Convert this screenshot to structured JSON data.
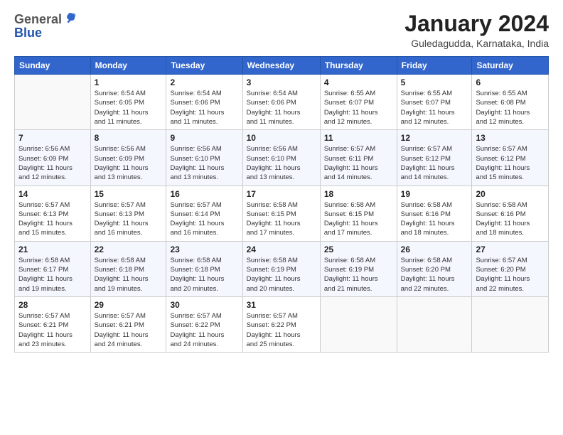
{
  "header": {
    "logo": {
      "line1": "General",
      "line2": "Blue"
    },
    "title": "January 2024",
    "location": "Guledagudda, Karnataka, India"
  },
  "calendar": {
    "days_of_week": [
      "Sunday",
      "Monday",
      "Tuesday",
      "Wednesday",
      "Thursday",
      "Friday",
      "Saturday"
    ],
    "weeks": [
      [
        {
          "day": "",
          "detail": ""
        },
        {
          "day": "1",
          "detail": "Sunrise: 6:54 AM\nSunset: 6:05 PM\nDaylight: 11 hours\nand 11 minutes."
        },
        {
          "day": "2",
          "detail": "Sunrise: 6:54 AM\nSunset: 6:06 PM\nDaylight: 11 hours\nand 11 minutes."
        },
        {
          "day": "3",
          "detail": "Sunrise: 6:54 AM\nSunset: 6:06 PM\nDaylight: 11 hours\nand 11 minutes."
        },
        {
          "day": "4",
          "detail": "Sunrise: 6:55 AM\nSunset: 6:07 PM\nDaylight: 11 hours\nand 12 minutes."
        },
        {
          "day": "5",
          "detail": "Sunrise: 6:55 AM\nSunset: 6:07 PM\nDaylight: 11 hours\nand 12 minutes."
        },
        {
          "day": "6",
          "detail": "Sunrise: 6:55 AM\nSunset: 6:08 PM\nDaylight: 11 hours\nand 12 minutes."
        }
      ],
      [
        {
          "day": "7",
          "detail": "Sunrise: 6:56 AM\nSunset: 6:09 PM\nDaylight: 11 hours\nand 12 minutes."
        },
        {
          "day": "8",
          "detail": "Sunrise: 6:56 AM\nSunset: 6:09 PM\nDaylight: 11 hours\nand 13 minutes."
        },
        {
          "day": "9",
          "detail": "Sunrise: 6:56 AM\nSunset: 6:10 PM\nDaylight: 11 hours\nand 13 minutes."
        },
        {
          "day": "10",
          "detail": "Sunrise: 6:56 AM\nSunset: 6:10 PM\nDaylight: 11 hours\nand 13 minutes."
        },
        {
          "day": "11",
          "detail": "Sunrise: 6:57 AM\nSunset: 6:11 PM\nDaylight: 11 hours\nand 14 minutes."
        },
        {
          "day": "12",
          "detail": "Sunrise: 6:57 AM\nSunset: 6:12 PM\nDaylight: 11 hours\nand 14 minutes."
        },
        {
          "day": "13",
          "detail": "Sunrise: 6:57 AM\nSunset: 6:12 PM\nDaylight: 11 hours\nand 15 minutes."
        }
      ],
      [
        {
          "day": "14",
          "detail": "Sunrise: 6:57 AM\nSunset: 6:13 PM\nDaylight: 11 hours\nand 15 minutes."
        },
        {
          "day": "15",
          "detail": "Sunrise: 6:57 AM\nSunset: 6:13 PM\nDaylight: 11 hours\nand 16 minutes."
        },
        {
          "day": "16",
          "detail": "Sunrise: 6:57 AM\nSunset: 6:14 PM\nDaylight: 11 hours\nand 16 minutes."
        },
        {
          "day": "17",
          "detail": "Sunrise: 6:58 AM\nSunset: 6:15 PM\nDaylight: 11 hours\nand 17 minutes."
        },
        {
          "day": "18",
          "detail": "Sunrise: 6:58 AM\nSunset: 6:15 PM\nDaylight: 11 hours\nand 17 minutes."
        },
        {
          "day": "19",
          "detail": "Sunrise: 6:58 AM\nSunset: 6:16 PM\nDaylight: 11 hours\nand 18 minutes."
        },
        {
          "day": "20",
          "detail": "Sunrise: 6:58 AM\nSunset: 6:16 PM\nDaylight: 11 hours\nand 18 minutes."
        }
      ],
      [
        {
          "day": "21",
          "detail": "Sunrise: 6:58 AM\nSunset: 6:17 PM\nDaylight: 11 hours\nand 19 minutes."
        },
        {
          "day": "22",
          "detail": "Sunrise: 6:58 AM\nSunset: 6:18 PM\nDaylight: 11 hours\nand 19 minutes."
        },
        {
          "day": "23",
          "detail": "Sunrise: 6:58 AM\nSunset: 6:18 PM\nDaylight: 11 hours\nand 20 minutes."
        },
        {
          "day": "24",
          "detail": "Sunrise: 6:58 AM\nSunset: 6:19 PM\nDaylight: 11 hours\nand 20 minutes."
        },
        {
          "day": "25",
          "detail": "Sunrise: 6:58 AM\nSunset: 6:19 PM\nDaylight: 11 hours\nand 21 minutes."
        },
        {
          "day": "26",
          "detail": "Sunrise: 6:58 AM\nSunset: 6:20 PM\nDaylight: 11 hours\nand 22 minutes."
        },
        {
          "day": "27",
          "detail": "Sunrise: 6:57 AM\nSunset: 6:20 PM\nDaylight: 11 hours\nand 22 minutes."
        }
      ],
      [
        {
          "day": "28",
          "detail": "Sunrise: 6:57 AM\nSunset: 6:21 PM\nDaylight: 11 hours\nand 23 minutes."
        },
        {
          "day": "29",
          "detail": "Sunrise: 6:57 AM\nSunset: 6:21 PM\nDaylight: 11 hours\nand 24 minutes."
        },
        {
          "day": "30",
          "detail": "Sunrise: 6:57 AM\nSunset: 6:22 PM\nDaylight: 11 hours\nand 24 minutes."
        },
        {
          "day": "31",
          "detail": "Sunrise: 6:57 AM\nSunset: 6:22 PM\nDaylight: 11 hours\nand 25 minutes."
        },
        {
          "day": "",
          "detail": ""
        },
        {
          "day": "",
          "detail": ""
        },
        {
          "day": "",
          "detail": ""
        }
      ]
    ]
  }
}
